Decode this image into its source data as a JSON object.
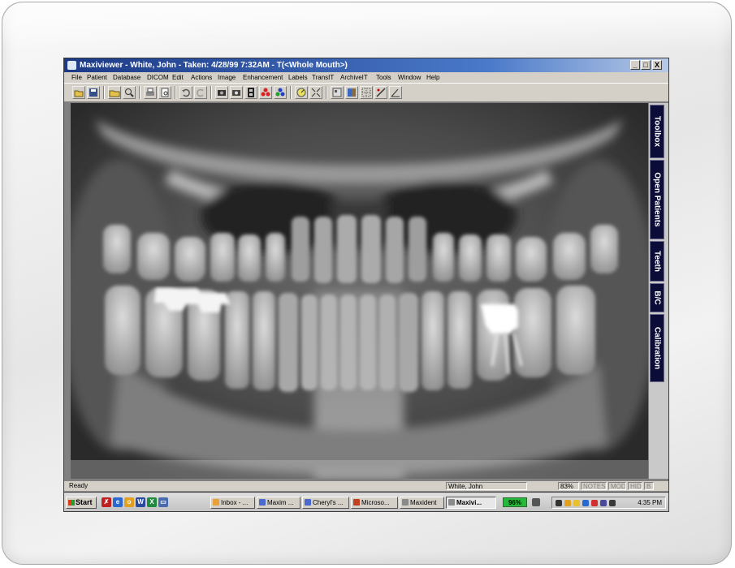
{
  "window": {
    "title": "Maxiviewer - White, John - Taken: 4/28/99 7:32AM - T(<Whole Mouth>)",
    "minimize": "_",
    "maximize": "□",
    "close": "X"
  },
  "menu": [
    "File",
    "Patient",
    "Database",
    "DICOM",
    "Edit",
    "Actions",
    "Image",
    "Enhancement",
    "Labels",
    "TransIT",
    "ArchiveIT",
    "Tools",
    "Window",
    "Help"
  ],
  "toolbar": {
    "buttons": [
      "open-icon",
      "save-icon",
      "open-folder-icon",
      "zoom-icon",
      "print-icon",
      "print-preview-icon",
      "undo-icon",
      "redo-icon",
      "camera-icon",
      "capture-icon",
      "film-icon",
      "color-dots-icon",
      "color-dots-icon",
      "gauge-icon",
      "fit-icon",
      "layout-icon",
      "layout-icon",
      "grid-icon",
      "measure-icon",
      "angle-icon"
    ]
  },
  "side_tabs": [
    "Toolbox",
    "Open Patients",
    "Teeth",
    "B/C",
    "Calibration"
  ],
  "status": {
    "text": "Ready",
    "patient": "White, John",
    "zoom": "83%",
    "notes": "NOTES",
    "mod": "MOD",
    "hid": "HID",
    "b": "B"
  },
  "taskbar": {
    "start": "Start",
    "quick_launch": [
      "acrobat-icon",
      "ie-icon",
      "outlook-icon",
      "word-icon",
      "excel-icon",
      "desktop-icon"
    ],
    "tasks": [
      {
        "label": "Inbox - ...",
        "active": false
      },
      {
        "label": "Maxim ...",
        "active": false
      },
      {
        "label": "Cheryl's ...",
        "active": false
      },
      {
        "label": "Microso...",
        "active": false
      },
      {
        "label": "Maxident",
        "active": false
      },
      {
        "label": "Maxivi...",
        "active": true
      }
    ],
    "battery": "96%",
    "clock": "4:35 PM"
  },
  "colors": {
    "title_start": "#1c3a86",
    "side_tab": "#0c0c38",
    "battery": "#26b83a"
  }
}
